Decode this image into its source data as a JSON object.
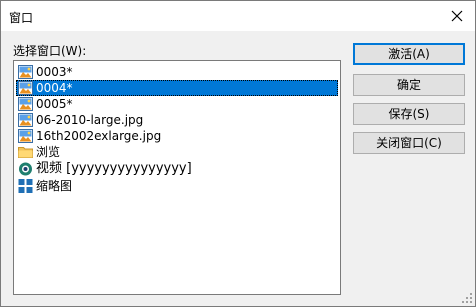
{
  "window": {
    "title": "窗口",
    "close_icon": "close-icon"
  },
  "list_label": "选择窗口(W):",
  "items": [
    {
      "label": "0003*",
      "icon": "image-icon",
      "selected": false
    },
    {
      "label": "0004*",
      "icon": "image-icon",
      "selected": true
    },
    {
      "label": "0005*",
      "icon": "image-icon",
      "selected": false
    },
    {
      "label": "06-2010-large.jpg",
      "icon": "image-icon",
      "selected": false
    },
    {
      "label": "16th2002exlarge.jpg",
      "icon": "image-icon",
      "selected": false
    },
    {
      "label": "浏览",
      "icon": "folder-icon",
      "selected": false
    },
    {
      "label": "视频 [yyyyyyyyyyyyyyy]",
      "icon": "video-icon",
      "selected": false
    },
    {
      "label": "缩略图",
      "icon": "thumbnails-icon",
      "selected": false
    }
  ],
  "buttons": {
    "activate": "激活(A)",
    "ok": "确定",
    "save": "保存(S)",
    "close_window": "关闭窗口(C)"
  },
  "colors": {
    "selection": "#0078d7",
    "default_button_border": "#0078d7"
  }
}
